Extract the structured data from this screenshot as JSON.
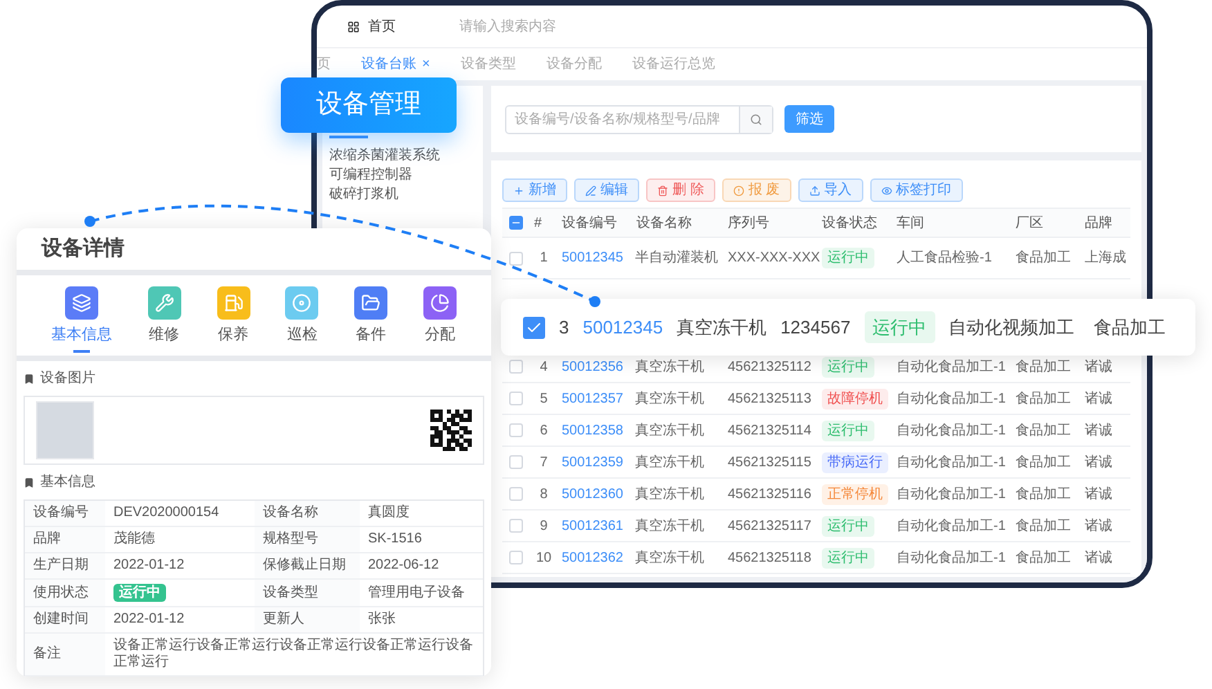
{
  "top_bar": {
    "home": "首页",
    "search_placeholder": "请输入搜索内容"
  },
  "tabs": [
    {
      "label": "页",
      "selected": false
    },
    {
      "label": "设备台账",
      "selected": true,
      "close": "×"
    },
    {
      "label": "设备类型",
      "selected": false
    },
    {
      "label": "设备分配",
      "selected": false
    },
    {
      "label": "设备运行总览",
      "selected": false
    }
  ],
  "sidebar": {
    "items": [
      "浓缩杀菌灌装系统",
      "可编程控制器",
      "破碎打浆机"
    ]
  },
  "search": {
    "placeholder": "设备编号/设备名称/规格型号/品牌",
    "button": "筛选"
  },
  "toolbar": [
    {
      "label": "新增",
      "kind": "primary"
    },
    {
      "label": "编辑",
      "kind": "primary"
    },
    {
      "label": "删 除",
      "kind": "danger"
    },
    {
      "label": "报 废",
      "kind": "warning"
    },
    {
      "label": "导入",
      "kind": "primary"
    },
    {
      "label": "标签打印",
      "kind": "primary"
    }
  ],
  "table": {
    "header_indeterminate": true,
    "columns": [
      "#",
      "设备编号",
      "设备名称",
      "序列号",
      "设备状态",
      "车间",
      "厂区",
      "品牌"
    ],
    "rows": [
      {
        "checked": false,
        "index": "1",
        "code": "50012345",
        "name": "半自动灌装机",
        "serial": "XXX-XXX-XXX",
        "status": {
          "text": "运行中",
          "kind": "running"
        },
        "workshop": "人工食品检验-1",
        "area": "食品加工",
        "brand": "上海成"
      },
      {
        "checked": false,
        "index": "4",
        "code": "50012356",
        "name": "真空冻干机",
        "serial": "45621325112",
        "status": {
          "text": "运行中",
          "kind": "running"
        },
        "workshop": "自动化食品加工-1",
        "area": "食品加工",
        "brand": "诸诚"
      },
      {
        "checked": false,
        "index": "5",
        "code": "50012357",
        "name": "真空冻干机",
        "serial": "45621325113",
        "status": {
          "text": "故障停机",
          "kind": "fault"
        },
        "workshop": "自动化食品加工-1",
        "area": "食品加工",
        "brand": "诸诚"
      },
      {
        "checked": false,
        "index": "6",
        "code": "50012358",
        "name": "真空冻干机",
        "serial": "45621325114",
        "status": {
          "text": "运行中",
          "kind": "running"
        },
        "workshop": "自动化食品加工-1",
        "area": "食品加工",
        "brand": "诸诚"
      },
      {
        "checked": false,
        "index": "7",
        "code": "50012359",
        "name": "真空冻干机",
        "serial": "45621325115",
        "status": {
          "text": "带病运行",
          "kind": "degraded"
        },
        "workshop": "自动化食品加工-1",
        "area": "食品加工",
        "brand": "诸诚"
      },
      {
        "checked": false,
        "index": "8",
        "code": "50012360",
        "name": "真空冻干机",
        "serial": "45621325116",
        "status": {
          "text": "正常停机",
          "kind": "stopped"
        },
        "workshop": "自动化食品加工-1",
        "area": "食品加工",
        "brand": "诸诚"
      },
      {
        "checked": false,
        "index": "9",
        "code": "50012361",
        "name": "真空冻干机",
        "serial": "45621325117",
        "status": {
          "text": "运行中",
          "kind": "running"
        },
        "workshop": "自动化食品加工-1",
        "area": "食品加工",
        "brand": "诸诚"
      },
      {
        "checked": false,
        "index": "10",
        "code": "50012362",
        "name": "真空冻干机",
        "serial": "45621325118",
        "status": {
          "text": "运行中",
          "kind": "running"
        },
        "workshop": "自动化食品加工-1",
        "area": "食品加工",
        "brand": "诸诚"
      }
    ]
  },
  "module_label": "设备管理",
  "highlight_row": {
    "checked": true,
    "index": "3",
    "code": "50012345",
    "name": "真空冻干机",
    "serial": "1234567",
    "status": {
      "text": "运行中",
      "kind": "running"
    },
    "workshop": "自动化视频加工",
    "area": "食品加工"
  },
  "detail_card": {
    "title": "设备详情",
    "tabs": [
      {
        "label": "基本信息",
        "selected": true,
        "color": "#5b7cf7"
      },
      {
        "label": "维修",
        "selected": false,
        "color": "#4fc7b5"
      },
      {
        "label": "保养",
        "selected": false,
        "color": "#f8bd1b"
      },
      {
        "label": "巡检",
        "selected": false,
        "color": "#6ccbf0"
      },
      {
        "label": "备件",
        "selected": false,
        "color": "#4f7ef5"
      },
      {
        "label": "分配",
        "selected": false,
        "color": "#8c62f5"
      }
    ],
    "photo_section": "设备图片",
    "info_section": "基本信息",
    "info_rows": [
      [
        {
          "label": "设备编号",
          "value": "DEV2020000154",
          "kind": "text"
        },
        {
          "label": "设备名称",
          "value": "真圆度",
          "kind": "text"
        }
      ],
      [
        {
          "label": "品牌",
          "value": "茂能德",
          "kind": "text"
        },
        {
          "label": "规格型号",
          "value": "SK-1516",
          "kind": "text"
        }
      ],
      [
        {
          "label": "生产日期",
          "value": "2022-01-12",
          "kind": "text"
        },
        {
          "label": "保修截止日期",
          "value": "2022-06-12",
          "kind": "text"
        }
      ],
      [
        {
          "label": "使用状态",
          "value": "运行中",
          "kind": "badge"
        },
        {
          "label": "设备类型",
          "value": "管理用电子设备",
          "kind": "text"
        }
      ],
      [
        {
          "label": "创建时间",
          "value": "2022-01-12",
          "kind": "text"
        },
        {
          "label": "更新人",
          "value": "张张",
          "kind": "text"
        }
      ],
      [
        {
          "label": "备注",
          "value": "设备正常运行设备正常运行设备正常运行设备正常运行设备正常运行",
          "kind": "text"
        }
      ]
    ]
  }
}
